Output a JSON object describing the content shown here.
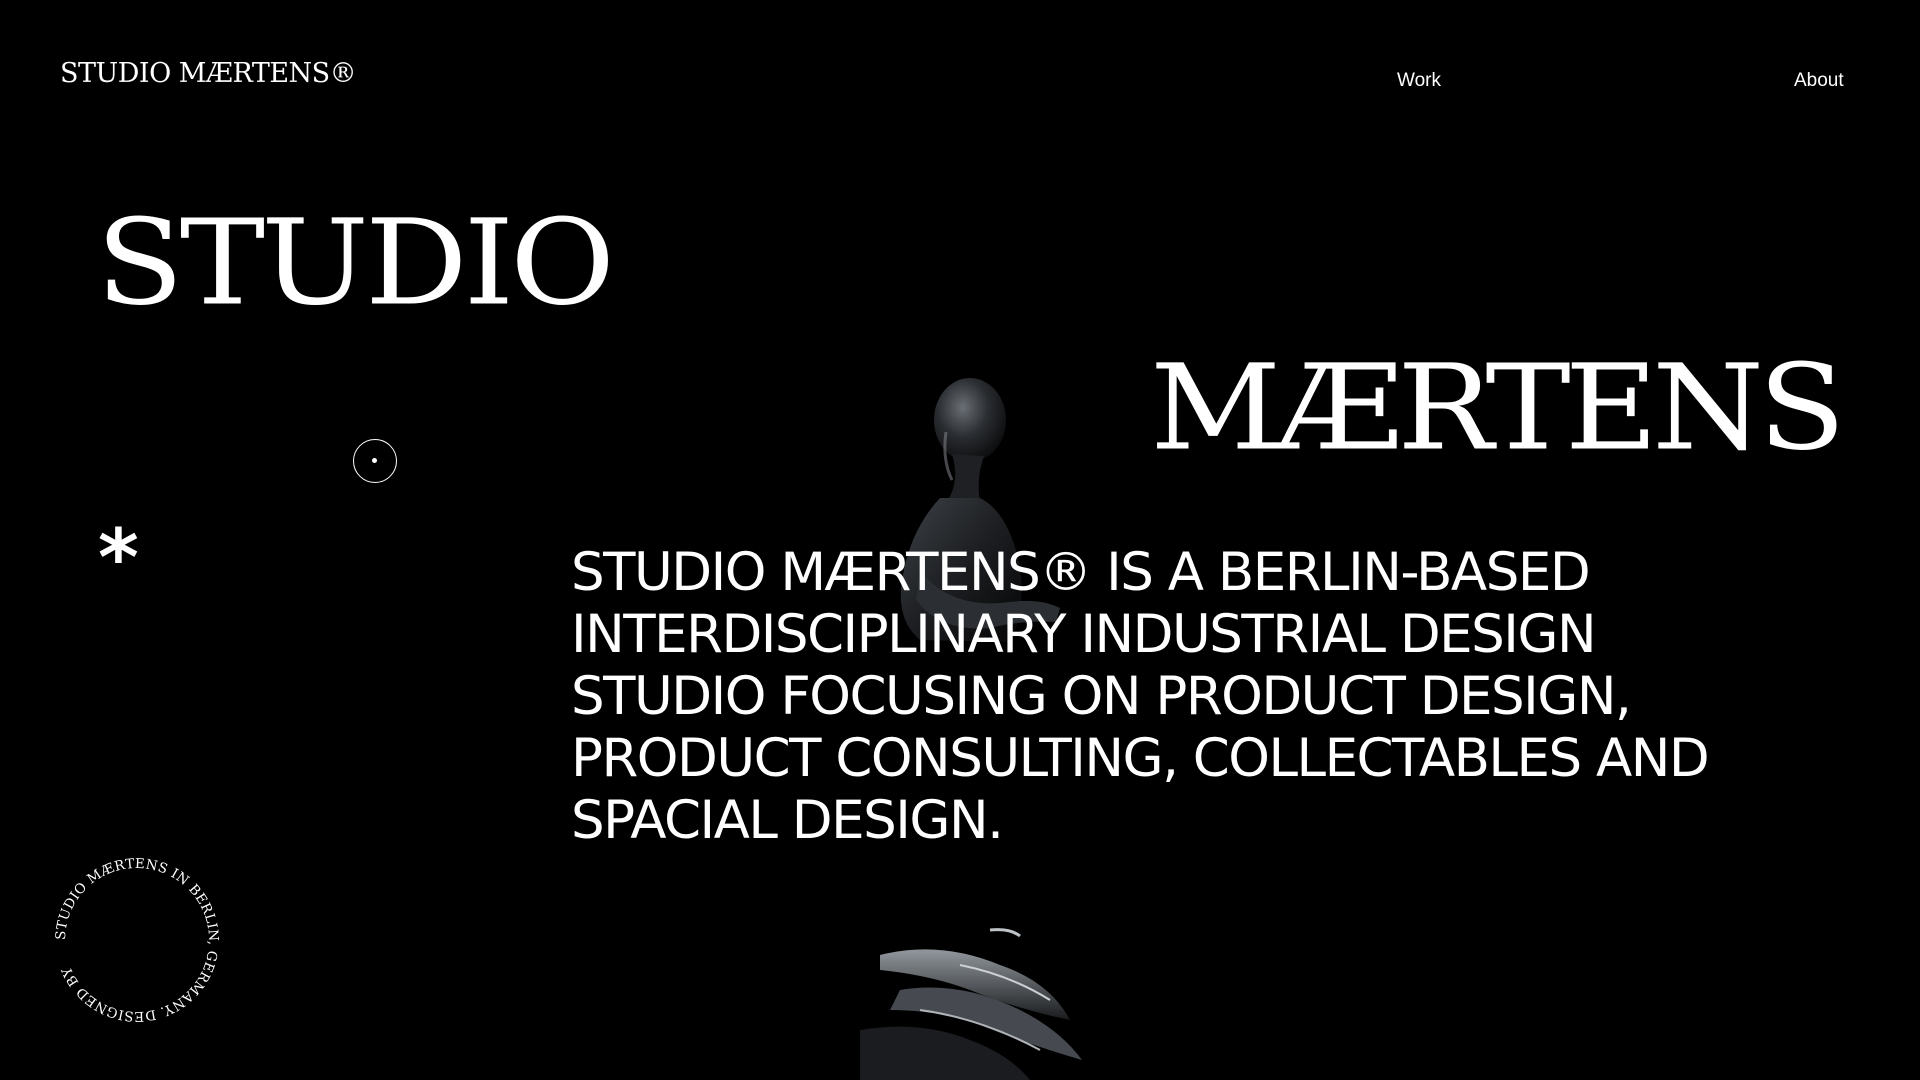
{
  "header": {
    "logo": "STUDIO MÆRTENS®",
    "nav": [
      {
        "label": "Work"
      },
      {
        "label": "About"
      }
    ]
  },
  "hero": {
    "word_1": "STUDIO",
    "word_2": "MÆRTENS",
    "asterisk": "*"
  },
  "description": {
    "lines": [
      "STUDIO MÆRTENS® IS A BERLIN-BASED",
      "INTERDISCIPLINARY INDUSTRIAL DESIGN",
      "STUDIO FOCUSING ON PRODUCT DESIGN,",
      "PRODUCT CONSULTING, COLLECTABLES AND",
      "SPACIAL DESIGN."
    ]
  },
  "badge": {
    "circular_text": "STUDIO MÆRTENS IN BERLIN, GERMANY. DESIGNED BY "
  },
  "colors": {
    "background": "#000000",
    "foreground": "#ffffff"
  },
  "icons": {
    "cursor": "cursor-ring-icon",
    "figure": "seated-figure-sculpture"
  }
}
